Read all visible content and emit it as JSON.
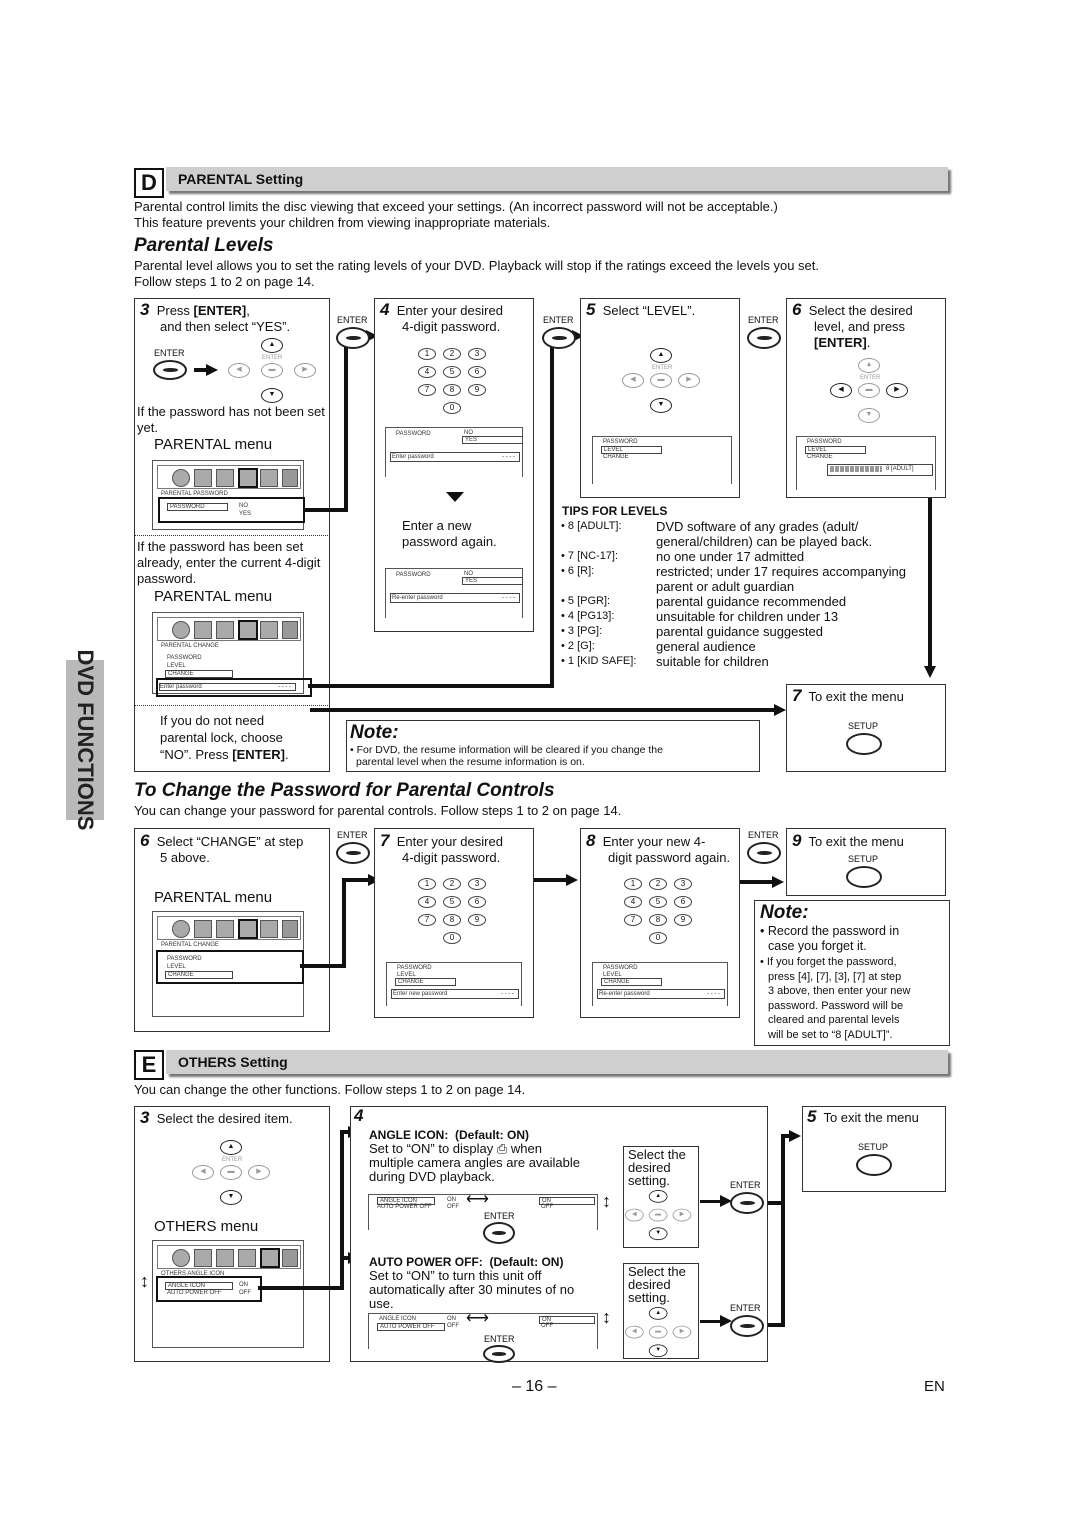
{
  "side_tab": "DVD FUNCTIONS",
  "section_d": {
    "letter": "D",
    "title": "PARENTAL Setting",
    "intro_1": "Parental control limits the disc viewing that exceed your settings. (An incorrect password will not be acceptable.)",
    "intro_2": "This feature prevents your children from viewing inappropriate materials."
  },
  "parental_levels": {
    "heading": "Parental Levels",
    "intro_1": "Parental level allows you to set the rating levels of your DVD. Playback will stop if the ratings exceed the levels you set.",
    "intro_2": "Follow steps 1 to 2 on page 14.",
    "step3": {
      "num": "3",
      "line1_pre": "Press ",
      "line1_key": "[ENTER]",
      "line1_post": ",",
      "line2": "and then select “YES”.",
      "enter_label": "ENTER",
      "not_set": "If the password has not been set yet.",
      "menu_label_1": "PARENTAL menu",
      "menu1_header": "PARENTAL  PASSWORD",
      "menu1_item": "PASSWORD",
      "menu1_no": "NO",
      "menu1_yes": "YES",
      "has_been_set": "If the password has been set already, enter the current 4-digit password.",
      "menu_label_2": "PARENTAL menu",
      "menu2_header": "PARENTAL  CHANGE",
      "menu2_items": [
        "PASSWORD",
        "LEVEL",
        "CHANGE"
      ],
      "menu2_prompt": "Enter password",
      "menu2_dashes": "- - - -",
      "no_need_1": "If you do not need",
      "no_need_2": "parental lock, choose",
      "no_need_3_pre": "“NO”. Press ",
      "no_need_3_key": "[ENTER]",
      "no_need_3_post": "."
    },
    "step4": {
      "num": "4",
      "line1": "Enter your desired",
      "line2": "4-digit password.",
      "keys": [
        "1",
        "2",
        "3",
        "4",
        "5",
        "6",
        "7",
        "8",
        "9",
        "0"
      ],
      "osd1_item": "PASSWORD",
      "osd1_no": "NO",
      "osd1_yes": "YES",
      "osd1_prompt": "Enter password",
      "osd1_dashes": "- - - -",
      "again_1": "Enter a new",
      "again_2": "password again.",
      "osd2_prompt": "Re-enter password"
    },
    "step5": {
      "num": "5",
      "line1": "Select “LEVEL”.",
      "osd_items": [
        "PASSWORD",
        "LEVEL",
        "CHANGE"
      ]
    },
    "step6": {
      "num": "6",
      "line1": "Select the desired",
      "line2": "level, and press",
      "line3": "[ENTER]",
      "line3_post": ".",
      "osd_items": [
        "PASSWORD",
        "LEVEL",
        "CHANGE"
      ],
      "level_value": "8 [ADULT]",
      "level_fill": 8,
      "level_max": 8
    },
    "step7": {
      "num": "7",
      "line1": "To exit the menu",
      "setup_label": "SETUP"
    },
    "enter_label": "ENTER",
    "tips": {
      "title": "TIPS FOR LEVELS",
      "items": [
        {
          "key": "• 8 [ADULT]:",
          "desc": "DVD software of any grades (adult/ general/children) can be played back."
        },
        {
          "key": "• 7 [NC-17]:",
          "desc": "no one under 17 admitted"
        },
        {
          "key": "• 6 [R]:",
          "desc": "restricted; under 17 requires accompanying parent or adult guardian"
        },
        {
          "key": "• 5 [PGR]:",
          "desc": "parental guidance recommended"
        },
        {
          "key": "• 4 [PG13]:",
          "desc": "unsuitable for children under 13"
        },
        {
          "key": "• 3 [PG]:",
          "desc": "parental guidance suggested"
        },
        {
          "key": "• 2 [G]:",
          "desc": "general audience"
        },
        {
          "key": "• 1 [KID SAFE]:",
          "desc": "suitable for children"
        }
      ]
    },
    "note": {
      "title": "Note:",
      "text_1": "• For DVD, the resume information will be cleared if you change the",
      "text_2": "parental level when the resume information is on."
    }
  },
  "change_password": {
    "heading": "To Change the Password for Parental Controls",
    "intro": "You can change your password for parental controls. Follow steps 1 to 2 on page 14.",
    "step6": {
      "num": "6",
      "line1": "Select “CHANGE” at step",
      "line2": "5 above.",
      "menu_label": "PARENTAL menu",
      "menu_header": "PARENTAL  CHANGE",
      "menu_items": [
        "PASSWORD",
        "LEVEL",
        "CHANGE"
      ]
    },
    "step7": {
      "num": "7",
      "line1": "Enter your desired",
      "line2": "4-digit password.",
      "osd_items": [
        "PASSWORD",
        "LEVEL",
        "CHANGE"
      ],
      "prompt": "Enter new password",
      "dashes": "- - - -"
    },
    "step8": {
      "num": "8",
      "line1": "Enter your new 4-",
      "line2": "digit password again.",
      "osd_items": [
        "PASSWORD",
        "LEVEL",
        "CHANGE"
      ],
      "prompt": "Re-enter password",
      "dashes": "- - - -"
    },
    "step9": {
      "num": "9",
      "line1": "To exit the menu",
      "setup_label": "SETUP"
    },
    "enter_label": "ENTER",
    "note": {
      "title": "Note:",
      "b1_1": "• Record the password in",
      "b1_2": "case you forget it.",
      "b2_1": "• If you forget the password,",
      "b2_2": "press [4], [7], [3], [7] at step",
      "b2_3": "3 above, then enter your new",
      "b2_4": "password. Password will be",
      "b2_5": "cleared and parental levels",
      "b2_6": "will be set to “8 [ADULT]”."
    }
  },
  "section_e": {
    "letter": "E",
    "title": "OTHERS Setting",
    "intro": "You can change the other functions. Follow steps 1 to 2 on page 14.",
    "step3": {
      "num": "3",
      "line1": "Select the desired item.",
      "menu_label": "OTHERS menu",
      "menu_header": "OTHERS  ANGLE ICON",
      "row1_label": "ANGLE ICON",
      "row1_val": "ON",
      "row2_label": "AUTO POWER OFF",
      "row2_val": "OFF"
    },
    "step4": {
      "num": "4",
      "angle": {
        "title": "ANGLE ICON:",
        "default": "(Default: ON)",
        "d1": "Set to “ON” to display ⎙ when",
        "d2": "multiple camera angles are available",
        "d3": "during DVD playback.",
        "callout_1": "Select the",
        "callout_2": "desired",
        "callout_3": "setting."
      },
      "auto": {
        "title": "AUTO POWER OFF:",
        "default": "(Default: ON)",
        "d1": "Set to “ON” to turn this unit off",
        "d2": "automatically after 30 minutes of no",
        "d3": "use.",
        "callout_1": "Select the",
        "callout_2": "desired",
        "callout_3": "setting."
      },
      "osd_row1": "ANGLE ICON",
      "osd_row2": "AUTO POWER OFF",
      "osd_on": "ON",
      "osd_off": "OFF"
    },
    "step5": {
      "num": "5",
      "line1": "To exit the menu",
      "setup_label": "SETUP"
    },
    "enter_label": "ENTER"
  },
  "footer": {
    "page": "– 16 –",
    "lang": "EN"
  }
}
